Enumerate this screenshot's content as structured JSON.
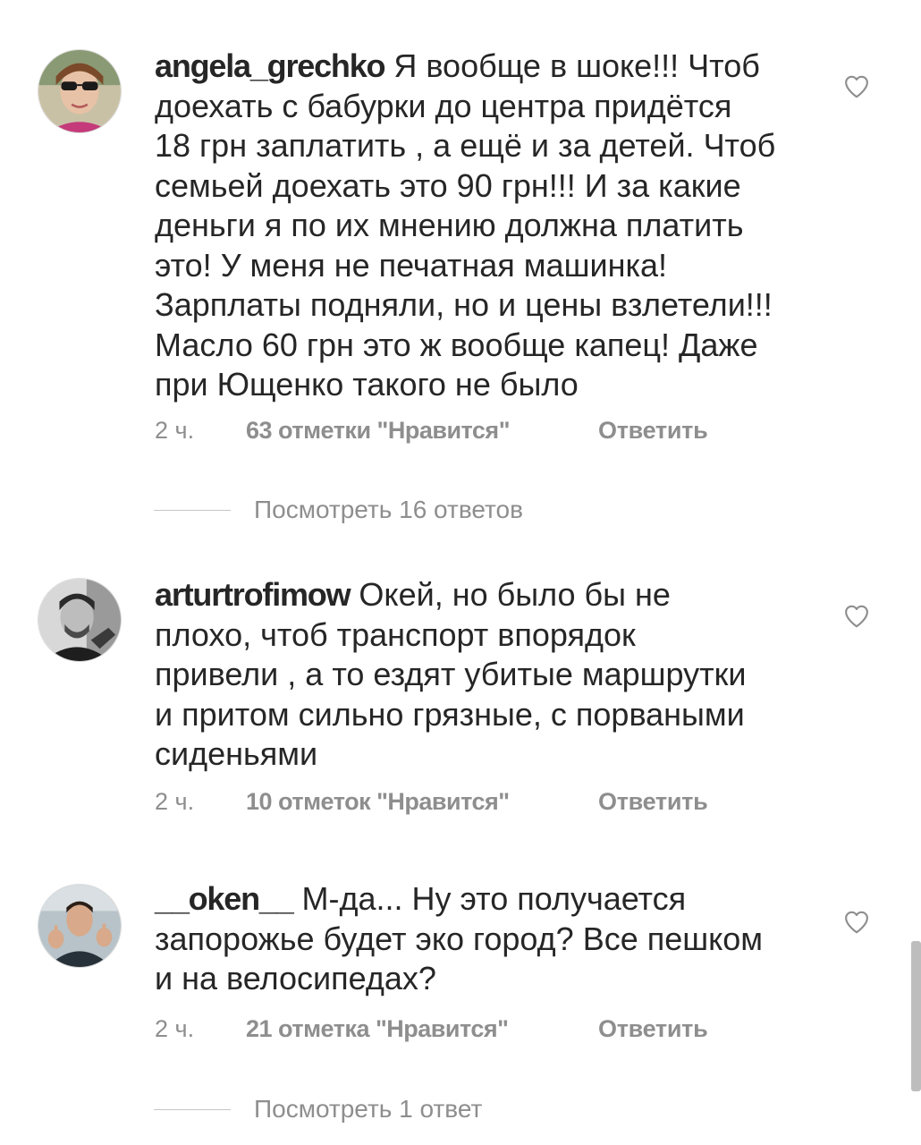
{
  "comments": [
    {
      "username": "angela_grechko",
      "avatar_icon": "avatar-woman-sunglasses",
      "lines": [
        "Я вообще в шоке!!! Чтоб",
        "доехать с бабурки до центра придётся",
        "18 грн заплатить , а ещё и за детей. Чтоб",
        "семьей доехать это 90 грн!!! И за какие",
        "деньги я по их мнению должна платить",
        "это! У меня не печатная машинка!",
        "Зарплаты подняли, но и цены взлетели!!!",
        "Масло 60 грн это ж вообще капец! Даже",
        "при Ющенко такого не было"
      ],
      "time": "2 ч.",
      "likes": "63 отметки \"Нравится\"",
      "reply": "Ответить",
      "view_replies": "Посмотреть 16 ответов"
    },
    {
      "username": "arturtrofimow",
      "avatar_icon": "avatar-man-bw",
      "lines": [
        "Окей, но было бы не",
        "плохо,  чтоб транспорт впорядок",
        "привели , а то ездят убитые маршрутки",
        "и притом сильно грязные, с порваными",
        "сиденьями"
      ],
      "time": "2 ч.",
      "likes": "10 отметок \"Нравится\"",
      "reply": "Ответить",
      "view_replies": ""
    },
    {
      "username": "__oken__",
      "avatar_icon": "avatar-man-gesture",
      "lines": [
        "М-да... Ну это получается",
        "запорожье будет эко город? Все пешком",
        "и на велосипедах?"
      ],
      "time": "2 ч.",
      "likes": "21 отметка \"Нравится\"",
      "reply": "Ответить",
      "view_replies": "Посмотреть 1 ответ"
    }
  ],
  "icons": {
    "like": "heart-outline-icon"
  },
  "colors": {
    "text": "#262626",
    "secondary": "#8e8e8e",
    "divider": "#c7c7c7"
  }
}
